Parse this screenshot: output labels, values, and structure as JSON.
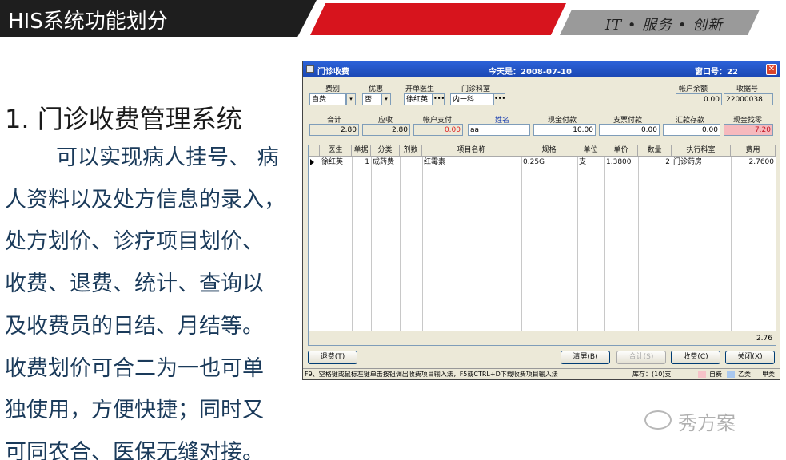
{
  "header": {
    "title": "HIS系统功能划分",
    "slogan": "IT • 服务 • 创新"
  },
  "content": {
    "heading": "1. 门诊收费管理系统",
    "lines": [
      "可以实现病人挂号、 病",
      "人资料以及处方信息的录入，",
      "处方划价、诊疗项目划价、",
      "收费、退费、统计、查询以",
      "及收费员的日结、月结等。",
      "收费划价可合二为一也可单",
      "独使用，方便快捷；同时又",
      "可同农合、医保无缝对接。"
    ]
  },
  "window": {
    "title": "门诊收费",
    "today": "今天是：2008-07-10",
    "window_no": "窗口号：22",
    "close": "✕",
    "row1": {
      "fee_type_label": "费别",
      "fee_type_value": "自费",
      "discount_label": "优惠",
      "discount_value": "否",
      "doctor_label": "开单医生",
      "doctor_value": "徐红英",
      "dept_label": "门诊科室",
      "dept_value": "内一科",
      "balance_label": "帐户余额",
      "balance_value": "0.00",
      "receipt_label": "收据号",
      "receipt_value": "22000038"
    },
    "row2": {
      "total_label": "合计",
      "total_value": "2.80",
      "due_label": "应收",
      "due_value": "2.80",
      "account_pay_label": "帐户支付",
      "account_pay_value": "0.00",
      "name_label": "姓名",
      "name_value": "aa",
      "cash_label": "现金付款",
      "cash_value": "10.00",
      "check_label": "支票付款",
      "check_value": "0.00",
      "remit_label": "汇款存款",
      "remit_value": "0.00",
      "change_label": "现金找零",
      "change_value": "7.20"
    },
    "grid": {
      "headers": [
        "医生",
        "单据",
        "分类",
        "剂数",
        "项目名称",
        "规格",
        "单位",
        "单价",
        "数量",
        "执行科室",
        "费用"
      ],
      "rows": [
        [
          "徐红英",
          "1",
          "成药费",
          "",
          "红霉素",
          "0.25G",
          "支",
          "1.3800",
          "2",
          "门诊药房",
          "2.7600"
        ]
      ],
      "total": "2.76"
    },
    "buttons": {
      "refund": "退费(T)",
      "clear": "清屏(B)",
      "sum": "合计(S)",
      "charge": "收费(C)",
      "close": "关闭(X)"
    },
    "status": {
      "hint": "F9、空格键或鼠标左键单击按钮调出收费项目输入法，F5或CTRL+D下载收费项目输入法",
      "stock": "库存：(10)支",
      "legend_self": "自费",
      "legend_b": "乙类",
      "legend_a": "甲类"
    }
  },
  "watermark": "秀方案",
  "colors": {
    "accent_red": "#d7141d",
    "header_dark": "#1e1e1e",
    "header_gray": "#9a9a9a",
    "text_blue": "#1a3a5a"
  }
}
